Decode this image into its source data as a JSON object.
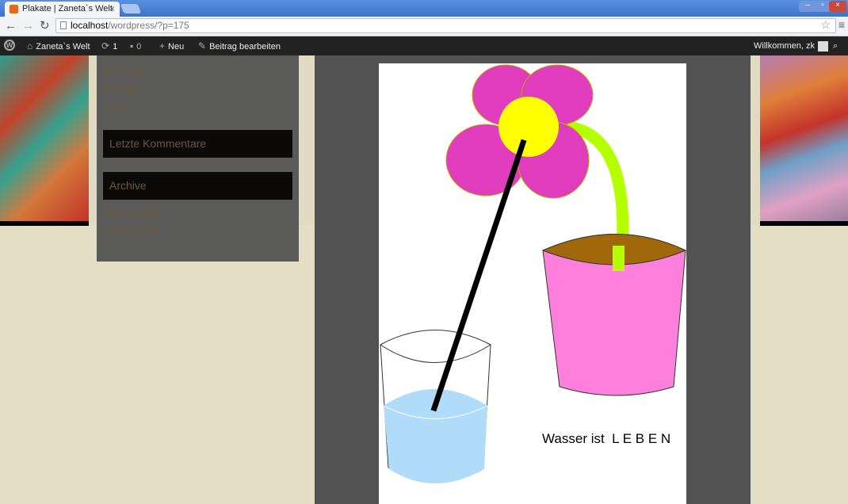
{
  "browser": {
    "tab_title": "Plakate | Zaneta`s Welt",
    "tab_close": "×",
    "url_host": "localhost",
    "url_path": "/wordpress/?p=175",
    "icons": {
      "back": "back-arrow-icon",
      "forward": "forward-arrow-icon",
      "reload": "reload-icon",
      "star": "bookmark-star-icon",
      "menu": "menu-icon"
    }
  },
  "adminbar": {
    "site_name": "Zaneta`s Welt",
    "updates_count": "1",
    "comments_count": "0",
    "new_label": "Neu",
    "edit_label": "Beitrag bearbeiten",
    "greeting": "Willkommen, zk"
  },
  "sidebar": {
    "top_links": [
      "Anmelden",
      "Beiträge",
      "Feed"
    ],
    "widget_recent_comments": "Letzte Kommentare",
    "widget_archive": "Archive",
    "archive_links": [
      "Februar 2014",
      "Januar 2014"
    ]
  },
  "poster": {
    "caption": "Wasser ist  L E B E N"
  },
  "colors": {
    "petals": "#df3cbe",
    "center": "#ffff00",
    "stem": "#b4ff00",
    "pot": "#ff80dc",
    "soil": "#a0680a",
    "water": "#b0dcfa"
  }
}
